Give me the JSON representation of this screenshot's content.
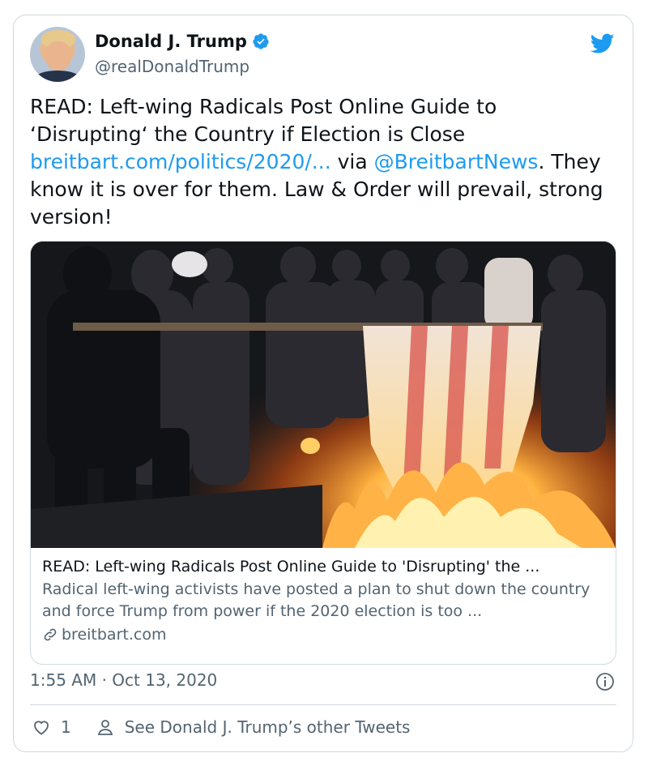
{
  "author": {
    "name": "Donald J. Trump",
    "handle": "@realDonaldTrump",
    "verified": true
  },
  "tweet": {
    "text_line_start": "READ: Left-wing Radicals Post Online Guide to ‘Disrupting‘ the Country if Election is Close ",
    "link_url": "breitbart.com/politics/2020/...",
    "via_text": " via ",
    "mention": "@BreitbartNews",
    "text_end": ". They know it is over for them. Law & Order will prevail, strong version!"
  },
  "link_card": {
    "title": "READ: Left-wing Radicals Post Online Guide to 'Disrupting' the ...",
    "description": "Radical left-wing activists have posted a plan to shut down the country and force Trump from power if the 2020 election is too ...",
    "domain": "breitbart.com"
  },
  "meta": {
    "timestamp": "1:55 AM · Oct 13, 2020"
  },
  "actions": {
    "like_count": "1",
    "see_others": "See Donald J. Trump’s other Tweets"
  },
  "colors": {
    "accent": "#1d9bf0",
    "text": "#0f1419",
    "secondary": "#536471",
    "border": "#cfd9de"
  },
  "icons": [
    "avatar",
    "verified-badge-icon",
    "twitter-bird-icon",
    "link-icon",
    "info-icon",
    "heart-icon",
    "person-icon"
  ]
}
